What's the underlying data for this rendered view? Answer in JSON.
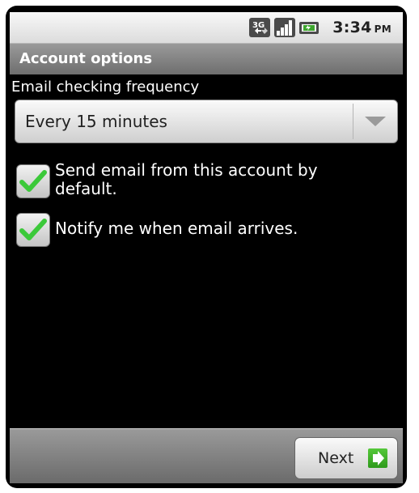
{
  "status_bar": {
    "time": "3:34",
    "ampm": "PM",
    "icons": [
      "3g-icon",
      "signal-icon",
      "battery-icon"
    ]
  },
  "title_bar": {
    "title": "Account options"
  },
  "frequency": {
    "label": "Email checking frequency",
    "selected": "Every 15 minutes"
  },
  "options": [
    {
      "label": "Send email from this account by default.",
      "checked": true
    },
    {
      "label": "Notify me when email arrives.",
      "checked": true
    }
  ],
  "footer": {
    "next_label": "Next"
  },
  "colors": {
    "check_green": "#3cc93a",
    "title_bar": "#808080",
    "background": "#000000"
  }
}
